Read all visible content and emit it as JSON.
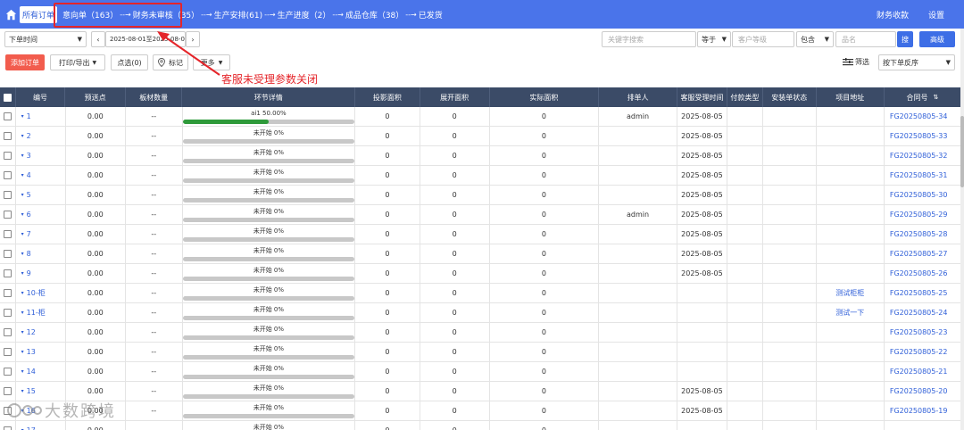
{
  "nav": {
    "all_orders": "所有订单",
    "steps": [
      {
        "label": "意向单（163）"
      },
      {
        "label": "财务未审核（35）"
      },
      {
        "label": "生产安排(61)"
      },
      {
        "label": "生产进度（2）"
      },
      {
        "label": "成品仓库（38）"
      },
      {
        "label": "已发货"
      }
    ],
    "arrow": "--→",
    "finance_collect": "财务收款",
    "settings": "设置"
  },
  "toolbar": {
    "time_select": "下单时间",
    "date_range": "2025-08-01至2025-08-0",
    "keyword_placeholder": "关键字搜索",
    "eq_select": "等于",
    "customer_level_placeholder": "客户等级",
    "contains_select": "包含",
    "product_name_placeholder": "品名",
    "search_btn": "搜",
    "advanced_btn": "高级",
    "add_order": "添加订单",
    "print_export": "打印/导出",
    "check_selected": "点选(0)",
    "mark": "标记",
    "more": "更多",
    "filter": "筛选",
    "sort_select": "按下单反序"
  },
  "annotation": "客服未受理参数关闭",
  "table": {
    "headers": [
      "编号",
      "预送点",
      "板材数量",
      "环节详情",
      "投影面积",
      "展开面积",
      "实际面积",
      "排单人",
      "客服受理时间",
      "付款类型",
      "安装单状态",
      "项目地址",
      "合同号"
    ],
    "rows": [
      {
        "id": "1",
        "pre": "0.00",
        "boards": "--",
        "stage": "ai1 50.00%",
        "progress": 0.5,
        "proj": "0",
        "unf": "0",
        "act": "0",
        "person": "admin",
        "time": "2025-08-05",
        "pay": "",
        "install": "",
        "addr": "",
        "contract": "FG20250805-34"
      },
      {
        "id": "2",
        "pre": "0.00",
        "boards": "--",
        "stage": "未开始 0%",
        "progress": 0,
        "proj": "0",
        "unf": "0",
        "act": "0",
        "person": "",
        "time": "2025-08-05",
        "pay": "",
        "install": "",
        "addr": "",
        "contract": "FG20250805-33"
      },
      {
        "id": "3",
        "pre": "0.00",
        "boards": "--",
        "stage": "未开始 0%",
        "progress": 0,
        "proj": "0",
        "unf": "0",
        "act": "0",
        "person": "",
        "time": "2025-08-05",
        "pay": "",
        "install": "",
        "addr": "",
        "contract": "FG20250805-32"
      },
      {
        "id": "4",
        "pre": "0.00",
        "boards": "--",
        "stage": "未开始 0%",
        "progress": 0,
        "proj": "0",
        "unf": "0",
        "act": "0",
        "person": "",
        "time": "2025-08-05",
        "pay": "",
        "install": "",
        "addr": "",
        "contract": "FG20250805-31"
      },
      {
        "id": "5",
        "pre": "0.00",
        "boards": "--",
        "stage": "未开始 0%",
        "progress": 0,
        "proj": "0",
        "unf": "0",
        "act": "0",
        "person": "",
        "time": "2025-08-05",
        "pay": "",
        "install": "",
        "addr": "",
        "contract": "FG20250805-30"
      },
      {
        "id": "6",
        "pre": "0.00",
        "boards": "--",
        "stage": "未开始 0%",
        "progress": 0,
        "proj": "0",
        "unf": "0",
        "act": "0",
        "person": "admin",
        "time": "2025-08-05",
        "pay": "",
        "install": "",
        "addr": "",
        "contract": "FG20250805-29"
      },
      {
        "id": "7",
        "pre": "0.00",
        "boards": "--",
        "stage": "未开始 0%",
        "progress": 0,
        "proj": "0",
        "unf": "0",
        "act": "0",
        "person": "",
        "time": "2025-08-05",
        "pay": "",
        "install": "",
        "addr": "",
        "contract": "FG20250805-28"
      },
      {
        "id": "8",
        "pre": "0.00",
        "boards": "--",
        "stage": "未开始 0%",
        "progress": 0,
        "proj": "0",
        "unf": "0",
        "act": "0",
        "person": "",
        "time": "2025-08-05",
        "pay": "",
        "install": "",
        "addr": "",
        "contract": "FG20250805-27"
      },
      {
        "id": "9",
        "pre": "0.00",
        "boards": "--",
        "stage": "未开始 0%",
        "progress": 0,
        "proj": "0",
        "unf": "0",
        "act": "0",
        "person": "",
        "time": "2025-08-05",
        "pay": "",
        "install": "",
        "addr": "",
        "contract": "FG20250805-26"
      },
      {
        "id": "10-柜",
        "pre": "0.00",
        "boards": "--",
        "stage": "未开始 0%",
        "progress": 0,
        "proj": "0",
        "unf": "0",
        "act": "0",
        "person": "",
        "time": "",
        "pay": "",
        "install": "",
        "addr": "测试柜柜",
        "contract": "FG20250805-25"
      },
      {
        "id": "11-柜",
        "pre": "0.00",
        "boards": "--",
        "stage": "未开始 0%",
        "progress": 0,
        "proj": "0",
        "unf": "0",
        "act": "0",
        "person": "",
        "time": "",
        "pay": "",
        "install": "",
        "addr": "测试一下",
        "contract": "FG20250805-24"
      },
      {
        "id": "12",
        "pre": "0.00",
        "boards": "--",
        "stage": "未开始 0%",
        "progress": 0,
        "proj": "0",
        "unf": "0",
        "act": "0",
        "person": "",
        "time": "",
        "pay": "",
        "install": "",
        "addr": "",
        "contract": "FG20250805-23"
      },
      {
        "id": "13",
        "pre": "0.00",
        "boards": "--",
        "stage": "未开始 0%",
        "progress": 0,
        "proj": "0",
        "unf": "0",
        "act": "0",
        "person": "",
        "time": "",
        "pay": "",
        "install": "",
        "addr": "",
        "contract": "FG20250805-22"
      },
      {
        "id": "14",
        "pre": "0.00",
        "boards": "--",
        "stage": "未开始 0%",
        "progress": 0,
        "proj": "0",
        "unf": "0",
        "act": "0",
        "person": "",
        "time": "",
        "pay": "",
        "install": "",
        "addr": "",
        "contract": "FG20250805-21"
      },
      {
        "id": "15",
        "pre": "0.00",
        "boards": "--",
        "stage": "未开始 0%",
        "progress": 0,
        "proj": "0",
        "unf": "0",
        "act": "0",
        "person": "",
        "time": "2025-08-05",
        "pay": "",
        "install": "",
        "addr": "",
        "contract": "FG20250805-20"
      },
      {
        "id": "16",
        "pre": "0.00",
        "boards": "--",
        "stage": "未开始 0%",
        "progress": 0,
        "proj": "0",
        "unf": "0",
        "act": "0",
        "person": "",
        "time": "2025-08-05",
        "pay": "",
        "install": "",
        "addr": "",
        "contract": "FG20250805-19"
      },
      {
        "id": "17",
        "pre": "0.00",
        "boards": "--",
        "stage": "未开始 0%",
        "progress": 0,
        "proj": "0",
        "unf": "0",
        "act": "0",
        "person": "",
        "time": "",
        "pay": "",
        "install": "",
        "addr": "",
        "contract": ""
      }
    ]
  },
  "watermark": "大数跨境",
  "colors": {
    "nav_bg": "#4a74ea",
    "header_bg": "#3b4b67",
    "accent_red": "#e5252a",
    "progress_green": "#2e9a3a",
    "link_blue": "#2f5fd8"
  }
}
